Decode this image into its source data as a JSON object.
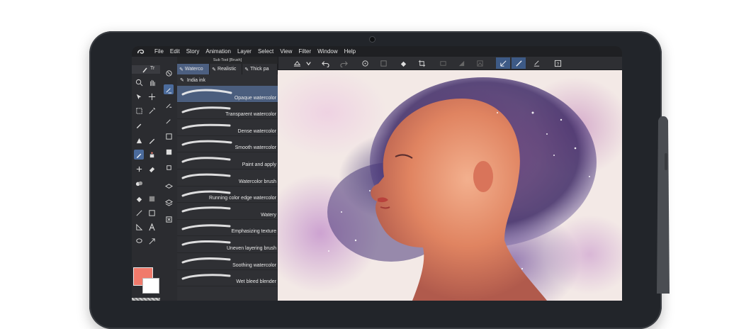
{
  "menubar": {
    "items": [
      "File",
      "Edit",
      "Story",
      "Animation",
      "Layer",
      "Select",
      "View",
      "Filter",
      "Window",
      "Help"
    ]
  },
  "brush_panel": {
    "title": "Sub Tool [Brush]",
    "tabs": [
      "Waterco",
      "Realistic",
      "Thick pa"
    ],
    "group_label": "India ink",
    "brushes": [
      "Opaque watercolor",
      "Transparent watercolor",
      "Dense watercolor",
      "Smooth watercolor",
      "Paint and apply",
      "Watercolor brush",
      "Running color edge watercolor",
      "Watery",
      "Emphasizing texture",
      "Uneven layering brush",
      "Soothing watercolor",
      "Wet bleed blender"
    ],
    "selected_index": 0
  },
  "tool_tab_label": "Tr",
  "colors": {
    "main_color": "#f07a6b",
    "sub_color": "#ffffff",
    "accent": "#4b6b9c"
  }
}
